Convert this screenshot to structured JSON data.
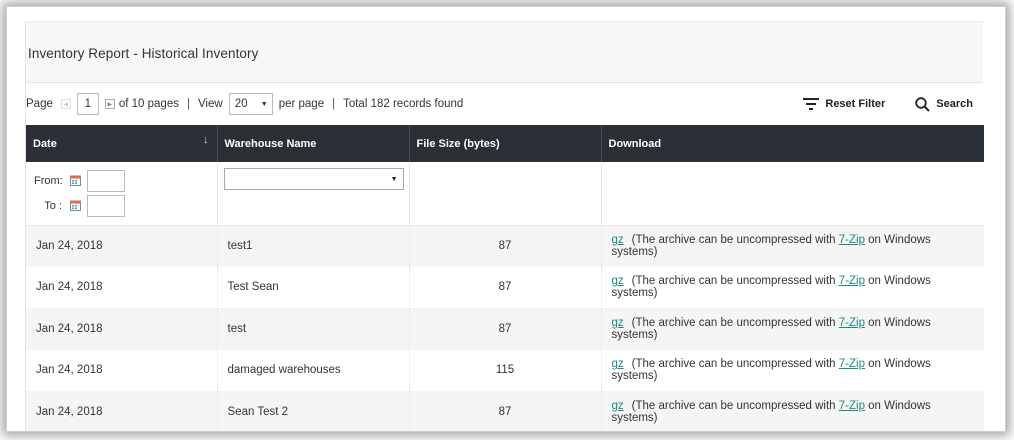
{
  "report": {
    "title": "Inventory Report - Historical Inventory"
  },
  "pager": {
    "page_label": "Page",
    "current_page": "1",
    "of_pages": "of 10 pages",
    "separator": "|",
    "view_label": "View",
    "per_page_value": "20",
    "per_page_label": "per page",
    "total": "Total 182 records found"
  },
  "toolbar": {
    "reset_filter": "Reset Filter",
    "search": "Search"
  },
  "table": {
    "columns": [
      "Date",
      "Warehouse Name",
      "File Size (bytes)",
      "Download"
    ],
    "sort_indicator": "↓",
    "filters": {
      "from_label": "From:",
      "to_label": "To :"
    },
    "rows": [
      {
        "date": "Jan 24, 2018",
        "warehouse": "test1",
        "size": "87"
      },
      {
        "date": "Jan 24, 2018",
        "warehouse": "Test Sean",
        "size": "87"
      },
      {
        "date": "Jan 24, 2018",
        "warehouse": "test",
        "size": "87"
      },
      {
        "date": "Jan 24, 2018",
        "warehouse": "damaged warehouses",
        "size": "115"
      },
      {
        "date": "Jan 24, 2018",
        "warehouse": "Sean Test 2",
        "size": "87"
      }
    ],
    "download": {
      "gz_label": "gz",
      "note_prefix": "(The archive can be uncompressed with ",
      "zip_link": "7-Zip",
      "note_suffix": " on Windows systems)"
    }
  },
  "colors": {
    "header_bg": "#2b2f36",
    "link": "#1a8a7f",
    "title_bar_bg": "#f7f7f7"
  }
}
